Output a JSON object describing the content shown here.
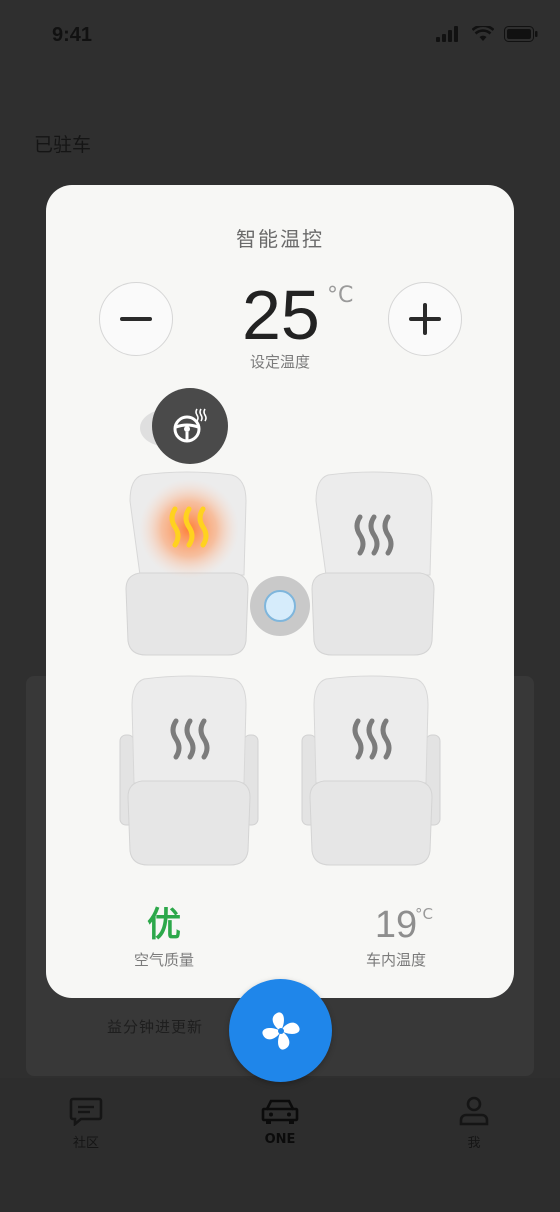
{
  "status": {
    "time": "9:41"
  },
  "page": {
    "heading": "已驻车",
    "background_text": "益分钟进更新"
  },
  "modal": {
    "title": "智能温控",
    "set_temperature": {
      "value": "25",
      "unit": "°C",
      "label": "设定温度"
    },
    "air_quality": {
      "value": "优",
      "label": "空气质量"
    },
    "inside_temperature": {
      "value": "19",
      "unit": "°C",
      "label": "车内温度"
    },
    "seats": [
      {
        "position": "front-left",
        "heating": true
      },
      {
        "position": "front-right",
        "heating": false
      },
      {
        "position": "rear-left",
        "heating": false
      },
      {
        "position": "rear-right",
        "heating": false
      }
    ],
    "steering_heat_active": true
  },
  "tabbar": {
    "items": [
      {
        "label": "社区",
        "icon": "message-icon",
        "active": false
      },
      {
        "label": "ONE",
        "icon": "car-icon",
        "active": true
      },
      {
        "label": "我",
        "icon": "person-icon",
        "active": false
      }
    ]
  },
  "colors": {
    "accent": "#1f86ea",
    "air_good": "#2ca84a",
    "heat_active": "#ff8a3c",
    "overlay": "#2f2f2f"
  }
}
